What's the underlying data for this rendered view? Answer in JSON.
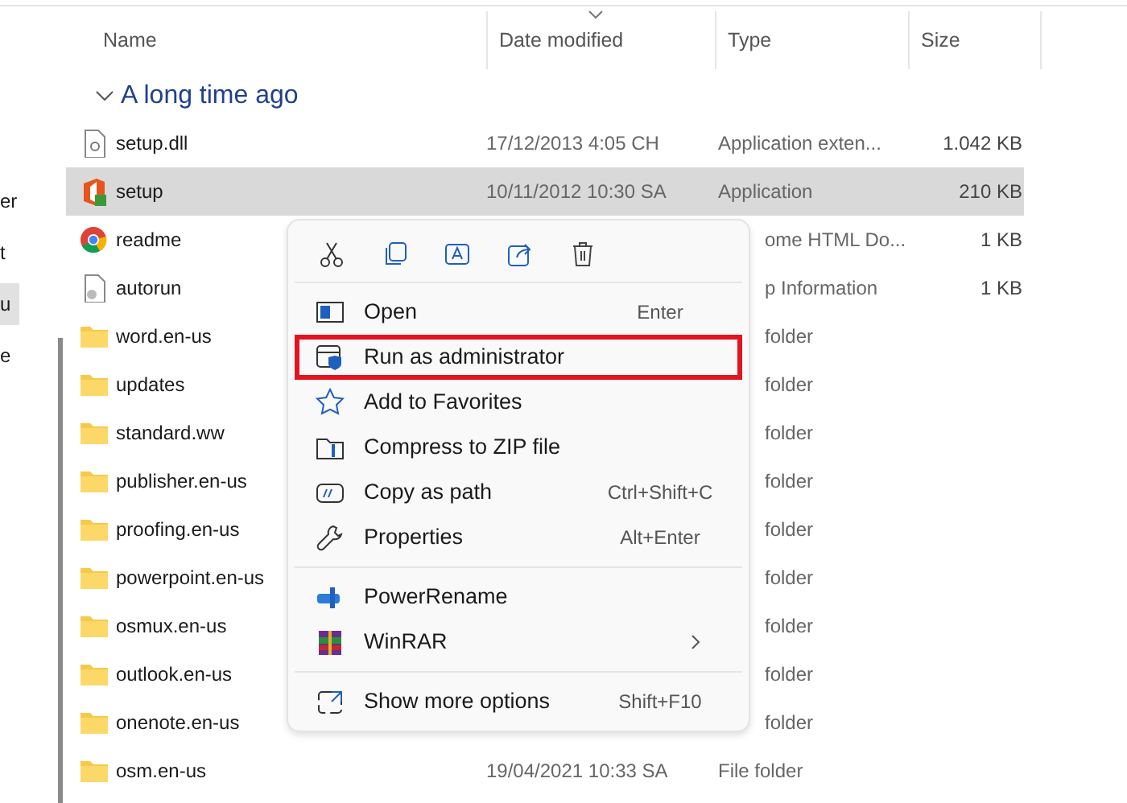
{
  "nav_pane": {
    "items": [
      {
        "label": "er",
        "selected": false
      },
      {
        "label": "t",
        "selected": false
      },
      {
        "label": "u",
        "selected": true
      },
      {
        "label": "e",
        "selected": false
      }
    ]
  },
  "columns": [
    {
      "label": "Name",
      "sorted": false
    },
    {
      "label": "Date modified",
      "sorted": true
    },
    {
      "label": "Type",
      "sorted": false
    },
    {
      "label": "Size",
      "sorted": false
    }
  ],
  "group": {
    "label": "A long time ago",
    "expanded": true
  },
  "files": [
    {
      "name": "setup.dll",
      "kind": "dll",
      "date": "17/12/2013 4:05 CH",
      "type": "Application exten...",
      "size": "1.042 KB",
      "selected": false
    },
    {
      "name": "setup",
      "kind": "office",
      "date": "10/11/2012 10:30 SA",
      "type": "Application",
      "size": "210 KB",
      "selected": true
    },
    {
      "name": "readme",
      "kind": "chrome",
      "type": "ome HTML Do...",
      "size": "1 KB",
      "selected": false
    },
    {
      "name": "autorun",
      "kind": "ini",
      "type": "p Information",
      "size": "1 KB",
      "selected": false
    },
    {
      "name": "word.en-us",
      "kind": "folder",
      "type": "folder",
      "selected": false
    },
    {
      "name": "updates",
      "kind": "folder",
      "type": "folder",
      "selected": false
    },
    {
      "name": "standard.ww",
      "kind": "folder",
      "type": "folder",
      "selected": false
    },
    {
      "name": "publisher.en-us",
      "kind": "folder",
      "type": "folder",
      "selected": false
    },
    {
      "name": "proofing.en-us",
      "kind": "folder",
      "type": "folder",
      "selected": false
    },
    {
      "name": "powerpoint.en-us",
      "kind": "folder",
      "type": "folder",
      "selected": false
    },
    {
      "name": "osmux.en-us",
      "kind": "folder",
      "type": "folder",
      "selected": false
    },
    {
      "name": "outlook.en-us",
      "kind": "folder",
      "type": "folder",
      "selected": false
    },
    {
      "name": "onenote.en-us",
      "kind": "folder",
      "type": "folder",
      "selected": false
    },
    {
      "name": "osm.en-us",
      "kind": "folder",
      "date": "19/04/2021 10:33 SA",
      "type": "File folder",
      "selected": false
    }
  ],
  "context_menu": {
    "toolbar": [
      {
        "kind": "cut"
      },
      {
        "kind": "copy"
      },
      {
        "kind": "rename"
      },
      {
        "kind": "share"
      },
      {
        "kind": "delete"
      }
    ],
    "sections": [
      [
        {
          "kind": "open",
          "label": "Open",
          "shortcut": "Enter",
          "highlighted": false
        },
        {
          "kind": "admin",
          "label": "Run as administrator",
          "highlighted": true
        },
        {
          "kind": "star",
          "label": "Add to Favorites",
          "highlighted": false
        },
        {
          "kind": "zip",
          "label": "Compress to ZIP file",
          "highlighted": false
        },
        {
          "kind": "path",
          "label": "Copy as path",
          "shortcut": "Ctrl+Shift+C",
          "highlighted": false
        },
        {
          "kind": "wrench",
          "label": "Properties",
          "shortcut": "Alt+Enter",
          "highlighted": false
        }
      ],
      [
        {
          "kind": "powerrename",
          "label": "PowerRename",
          "highlighted": false
        },
        {
          "kind": "winrar",
          "label": "WinRAR",
          "submenu": true,
          "highlighted": false
        }
      ],
      [
        {
          "kind": "more",
          "label": "Show more options",
          "shortcut": "Shift+F10",
          "highlighted": false
        }
      ]
    ]
  }
}
